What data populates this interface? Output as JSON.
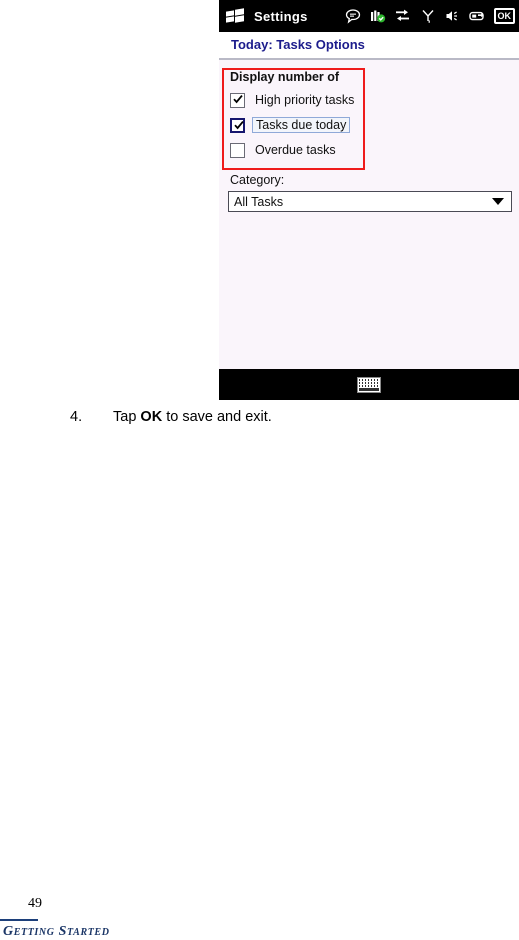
{
  "device": {
    "titlebar": {
      "app_title": "Settings",
      "start_icon": "windows-flag-icon",
      "status_icons": [
        {
          "name": "messaging-icon",
          "glyph": "messaging"
        },
        {
          "name": "signal-strength-icon",
          "glyph": "signal-bars-check"
        },
        {
          "name": "data-connection-icon",
          "glyph": "sync-arrows"
        },
        {
          "name": "antenna-icon",
          "glyph": "antenna"
        },
        {
          "name": "volume-icon",
          "glyph": "speaker"
        },
        {
          "name": "battery-icon",
          "glyph": "battery"
        }
      ],
      "ok_button_label": "OK"
    },
    "page_header": "Today: Tasks Options",
    "group": {
      "title": "Display number of",
      "checkboxes": [
        {
          "label": "High priority tasks",
          "checked": true,
          "focused": false
        },
        {
          "label": "Tasks due today",
          "checked": true,
          "focused": true
        },
        {
          "label": "Overdue tasks",
          "checked": false,
          "focused": false
        }
      ]
    },
    "category": {
      "label": "Category:",
      "selected": "All Tasks"
    },
    "sip_icon": "keyboard-icon",
    "annotation_color": "#ef1b1b"
  },
  "document": {
    "step_number": "4.",
    "step_text_before": "Tap ",
    "step_text_bold": "OK",
    "step_text_after": " to save and exit.",
    "page_number": "49",
    "footer_title": "Getting Started"
  }
}
